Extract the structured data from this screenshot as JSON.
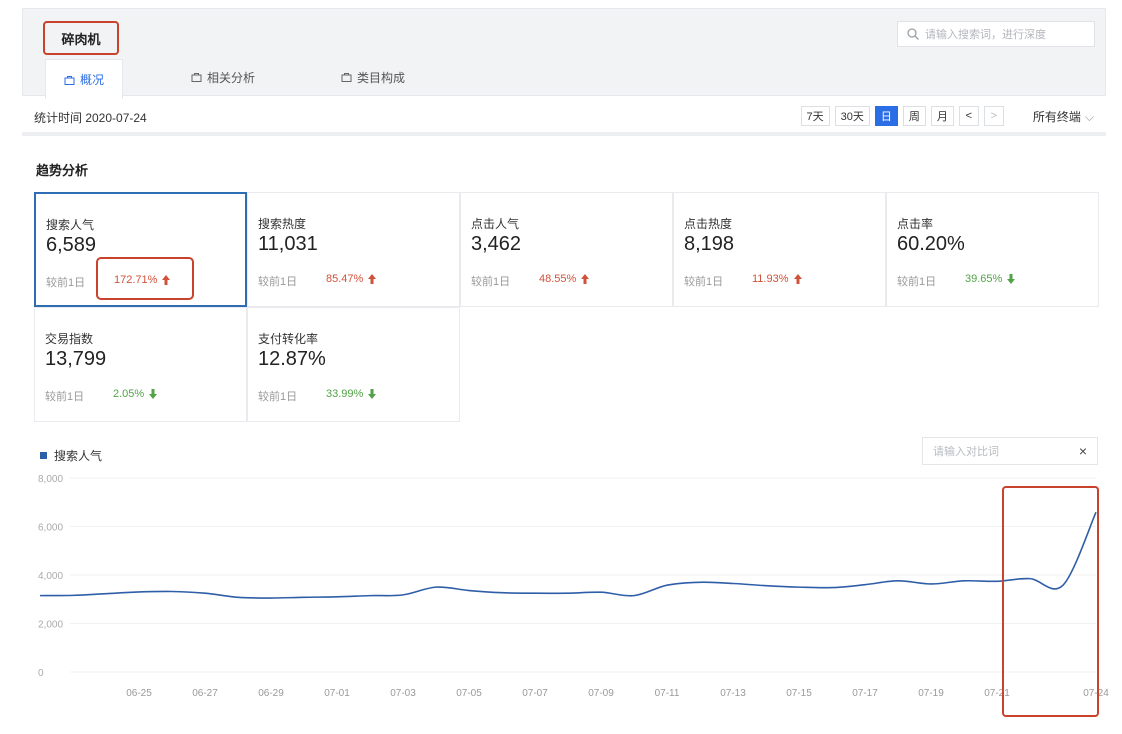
{
  "keyword": "碎肉机",
  "search": {
    "placeholder": "请输入搜索词，进行深度"
  },
  "tabs": [
    {
      "label": "概况"
    },
    {
      "label": "相关分析"
    },
    {
      "label": "类目构成"
    }
  ],
  "stat_time": "统计时间 2020-07-24",
  "range": {
    "d7": "7天",
    "d30": "30天",
    "day": "日",
    "week": "周",
    "month": "月",
    "prev": "<",
    "next": ">"
  },
  "device": "所有终端",
  "section_title": "趋势分析",
  "metrics": [
    {
      "name": "搜索人气",
      "value": "6,589",
      "compare": "较前1日",
      "change": "172.71%",
      "direction": "up"
    },
    {
      "name": "搜索热度",
      "value": "11,031",
      "compare": "较前1日",
      "change": "85.47%",
      "direction": "up"
    },
    {
      "name": "点击人气",
      "value": "3,462",
      "compare": "较前1日",
      "change": "48.55%",
      "direction": "up"
    },
    {
      "name": "点击热度",
      "value": "8,198",
      "compare": "较前1日",
      "change": "11.93%",
      "direction": "up"
    },
    {
      "name": "点击率",
      "value": "60.20%",
      "compare": "较前1日",
      "change": "39.65%",
      "direction": "down"
    },
    {
      "name": "交易指数",
      "value": "13,799",
      "compare": "较前1日",
      "change": "2.05%",
      "direction": "down"
    },
    {
      "name": "支付转化率",
      "value": "12.87%",
      "compare": "较前1日",
      "change": "33.99%",
      "direction": "down"
    }
  ],
  "compare": {
    "placeholder": "请输入对比词",
    "close": "×"
  },
  "colors": {
    "accent": "#2b6de5",
    "up": "#d2513a",
    "down": "#52a347",
    "line": "#2f5ea8",
    "highlight": "#c9422b"
  },
  "chart_data": {
    "type": "line",
    "series": [
      {
        "name": "搜索人气",
        "values": [
          3150,
          3160,
          3230,
          3300,
          3320,
          3250,
          3080,
          3050,
          3080,
          3100,
          3150,
          3180,
          3500,
          3360,
          3270,
          3250,
          3250,
          3290,
          3150,
          3580,
          3700,
          3650,
          3560,
          3500,
          3480,
          3600,
          3760,
          3630,
          3760,
          3740,
          3850,
          3580,
          6589
        ]
      }
    ],
    "x": [
      "06-22",
      "06-23",
      "06-24",
      "06-25",
      "06-26",
      "06-27",
      "06-28",
      "06-29",
      "06-30",
      "07-01",
      "07-02",
      "07-03",
      "07-04",
      "07-05",
      "07-06",
      "07-07",
      "07-08",
      "07-09",
      "07-10",
      "07-11",
      "07-12",
      "07-13",
      "07-14",
      "07-15",
      "07-16",
      "07-17",
      "07-18",
      "07-19",
      "07-20",
      "07-21",
      "07-22",
      "07-23",
      "07-24"
    ],
    "tick_labels": [
      "06-25",
      "06-27",
      "06-29",
      "07-01",
      "07-03",
      "07-05",
      "07-07",
      "07-09",
      "07-11",
      "07-13",
      "07-15",
      "07-17",
      "07-19",
      "07-21",
      "07-24"
    ],
    "y_ticks": [
      "0",
      "2,000",
      "4,000",
      "6,000",
      "8,000"
    ],
    "ylim": [
      0,
      8000
    ],
    "grid": true
  }
}
